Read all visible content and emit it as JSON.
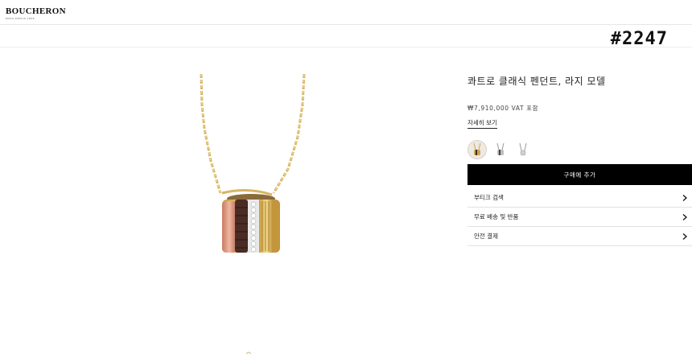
{
  "header": {
    "brand": "BOUCHERON",
    "brand_tagline": "PARIS DEPUIS 1858"
  },
  "overlay": {
    "watermark": "#2247"
  },
  "product": {
    "image_icon": "quatre-pendant-image",
    "title": "콰트로 클래식 펜던트, 라지 모델",
    "price": "₩7,910,000 VAT 포함",
    "details_link": "자세히 보기",
    "variants": [
      {
        "icon": "mixed-gold-pendant-icon",
        "selected": true
      },
      {
        "icon": "white-gold-pendant-icon",
        "selected": false
      },
      {
        "icon": "white-gold-small-pendant-icon",
        "selected": false
      }
    ],
    "add_to_cart": "구매에 추가",
    "accordion": [
      {
        "label": "부티크 검색",
        "icon": "chevron-right-icon"
      },
      {
        "label": "무료 배송 및 반품",
        "icon": "chevron-right-icon"
      },
      {
        "label": "안전 결제",
        "icon": "chevron-right-icon"
      }
    ]
  },
  "colors": {
    "button_bg": "#000000",
    "gold": "#d7b562",
    "rose_gold": "#d9927a",
    "brown_ceramic": "#4a2c24"
  }
}
